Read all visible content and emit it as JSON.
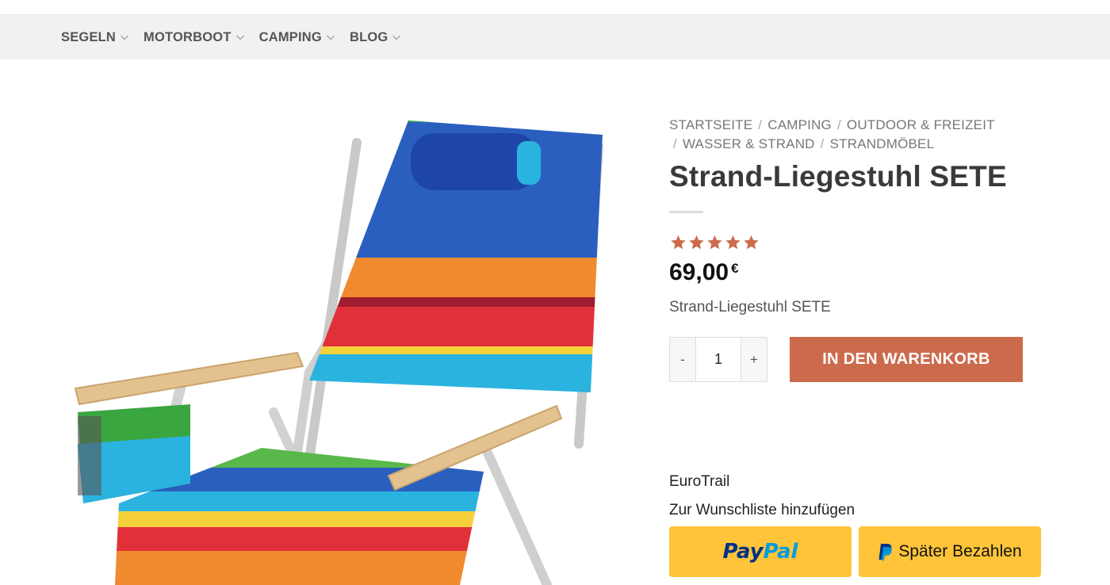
{
  "nav": {
    "items": [
      {
        "label": "SEGELN"
      },
      {
        "label": "MOTORBOOT"
      },
      {
        "label": "CAMPING"
      },
      {
        "label": "BLOG"
      }
    ]
  },
  "breadcrumb": {
    "items": [
      "STARTSEITE",
      "CAMPING",
      "OUTDOOR & FREIZEIT",
      "WASSER & STRAND",
      "STRANDMÖBEL"
    ],
    "separator": "/"
  },
  "product": {
    "title": "Strand-Liegestuhl SETE",
    "rating": 5,
    "rating_max": 5,
    "price": "69,00",
    "currency": "€",
    "short_description": "Strand-Liegestuhl SETE",
    "brand": "EuroTrail",
    "image_icon": "beach-chair-image"
  },
  "cart": {
    "minus_label": "-",
    "quantity": "1",
    "plus_label": "+",
    "add_label": "IN DEN WARENKORB"
  },
  "wishlist": {
    "label": "Zur Wunschliste hinzufügen"
  },
  "paypal": {
    "logo_part1": "Pay",
    "logo_part2": "Pal",
    "later_label": "Später Bezahlen"
  },
  "colors": {
    "accent": "#cc6b4c",
    "star": "#cc6b4c",
    "paypal_yellow": "#ffc439",
    "paypal_dark_blue": "#003087",
    "paypal_light_blue": "#009cde",
    "nav_bg": "#f1f1f1"
  }
}
